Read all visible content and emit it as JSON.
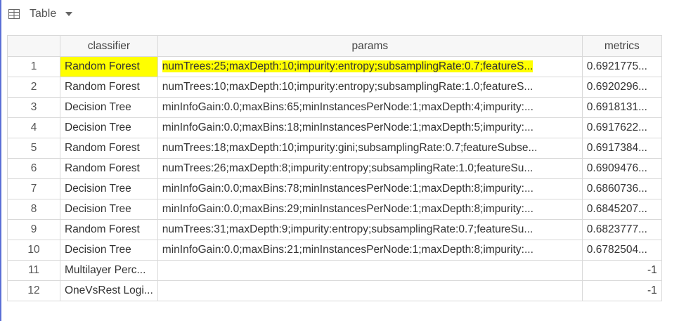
{
  "toolbar": {
    "view_label": "Table",
    "view_icon": "table-icon",
    "dropdown_icon": "caret-down-icon"
  },
  "table": {
    "columns": {
      "index": "",
      "classifier": "classifier",
      "params": "params",
      "metrics": "metrics"
    },
    "rows": [
      {
        "index": "1",
        "classifier": "Random Forest",
        "params": "numTrees:25;maxDepth:10;impurity:entropy;subsamplingRate:0.7;featureS...",
        "metrics": "0.6921775..."
      },
      {
        "index": "2",
        "classifier": "Random Forest",
        "params": "numTrees:10;maxDepth:10;impurity:entropy;subsamplingRate:1.0;featureS...",
        "metrics": "0.6920296..."
      },
      {
        "index": "3",
        "classifier": "Decision Tree",
        "params": "minInfoGain:0.0;maxBins:65;minInstancesPerNode:1;maxDepth:4;impurity:...",
        "metrics": "0.6918131..."
      },
      {
        "index": "4",
        "classifier": "Decision Tree",
        "params": "minInfoGain:0.0;maxBins:18;minInstancesPerNode:1;maxDepth:5;impurity:...",
        "metrics": "0.6917622..."
      },
      {
        "index": "5",
        "classifier": "Random Forest",
        "params": "numTrees:18;maxDepth:10;impurity:gini;subsamplingRate:0.7;featureSubse...",
        "metrics": "0.6917384..."
      },
      {
        "index": "6",
        "classifier": "Random Forest",
        "params": "numTrees:26;maxDepth:8;impurity:entropy;subsamplingRate:1.0;featureSu...",
        "metrics": "0.6909476..."
      },
      {
        "index": "7",
        "classifier": "Decision Tree",
        "params": "minInfoGain:0.0;maxBins:78;minInstancesPerNode:1;maxDepth:8;impurity:...",
        "metrics": "0.6860736..."
      },
      {
        "index": "8",
        "classifier": "Decision Tree",
        "params": "minInfoGain:0.0;maxBins:29;minInstancesPerNode:1;maxDepth:8;impurity:...",
        "metrics": "0.6845207..."
      },
      {
        "index": "9",
        "classifier": "Random Forest",
        "params": "numTrees:31;maxDepth:9;impurity:entropy;subsamplingRate:0.7;featureSu...",
        "metrics": "0.6823777..."
      },
      {
        "index": "10",
        "classifier": "Decision Tree",
        "params": "minInfoGain:0.0;maxBins:21;minInstancesPerNode:1;maxDepth:8;impurity:...",
        "metrics": "0.6782504..."
      },
      {
        "index": "11",
        "classifier": "Multilayer Perc...",
        "params": "",
        "metrics": "-1"
      },
      {
        "index": "12",
        "classifier": "OneVsRest Logi...",
        "params": "",
        "metrics": "-1"
      }
    ]
  },
  "highlight": {
    "color": "#ffff00"
  }
}
